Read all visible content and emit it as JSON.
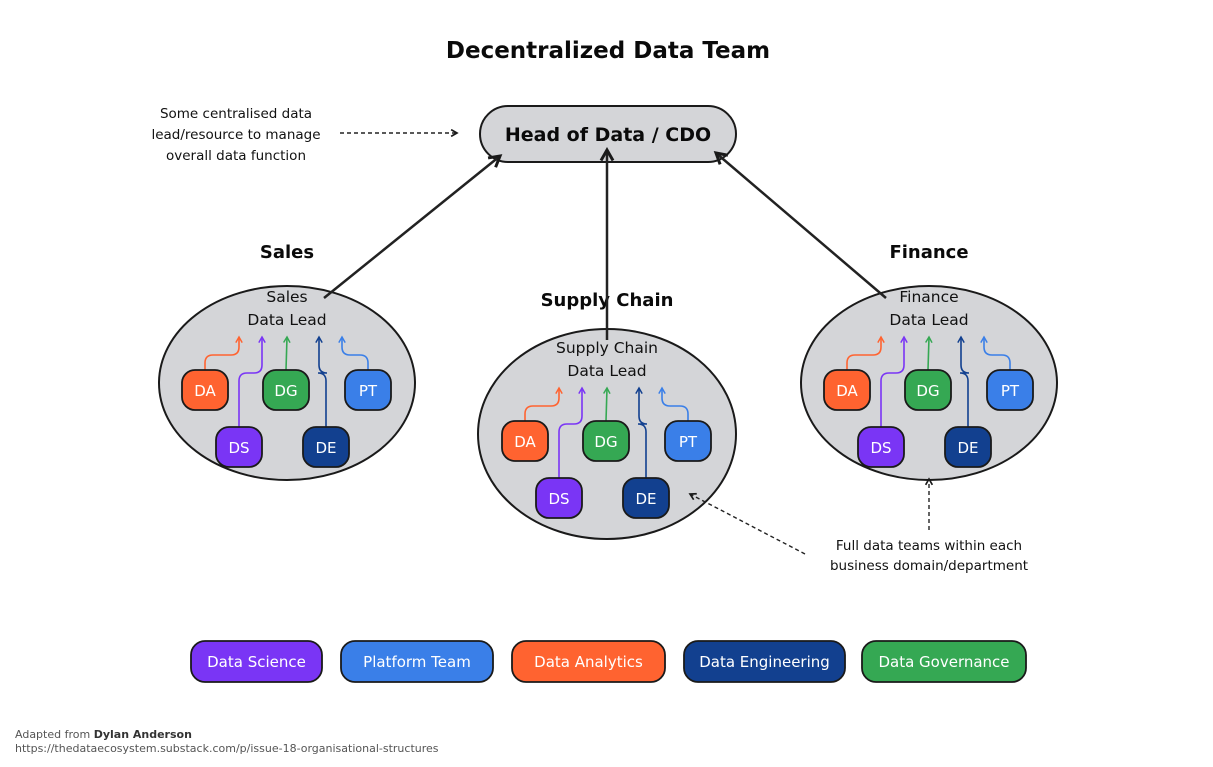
{
  "title": "Decentralized Data Team",
  "head": {
    "label": "Head of Data / CDO"
  },
  "annotations": {
    "central_lines": [
      "Some centralised data",
      "lead/resource to manage",
      "overall data function"
    ],
    "teams_lines": [
      "Full data teams within each",
      "business domain/department"
    ]
  },
  "colors": {
    "DA": "#ff6330",
    "DS": "#7a35f5",
    "DG": "#35a853",
    "DE": "#12408f",
    "PT": "#3a7fe8",
    "bubble_fill": "#d4d5d8",
    "outline": "#1a1a1a"
  },
  "departments": [
    {
      "name": "Sales",
      "lead_lines": [
        "Sales",
        "Data Lead"
      ],
      "members": [
        "DA",
        "DG",
        "PT",
        "DS",
        "DE"
      ]
    },
    {
      "name": "Supply Chain",
      "lead_lines": [
        "Supply Chain",
        "Data Lead"
      ],
      "members": [
        "DA",
        "DG",
        "PT",
        "DS",
        "DE"
      ]
    },
    {
      "name": "Finance",
      "lead_lines": [
        "Finance",
        "Data Lead"
      ],
      "members": [
        "DA",
        "DG",
        "PT",
        "DS",
        "DE"
      ]
    }
  ],
  "legend": [
    {
      "code": "DS",
      "label": "Data Science"
    },
    {
      "code": "PT",
      "label": "Platform Team"
    },
    {
      "code": "DA",
      "label": "Data Analytics"
    },
    {
      "code": "DE",
      "label": "Data Engineering"
    },
    {
      "code": "DG",
      "label": "Data Governance"
    }
  ],
  "credit": {
    "prefix": "Adapted from ",
    "author": "Dylan Anderson",
    "url": "https://thedataecosystem.substack.com/p/issue-18-organisational-structures"
  }
}
